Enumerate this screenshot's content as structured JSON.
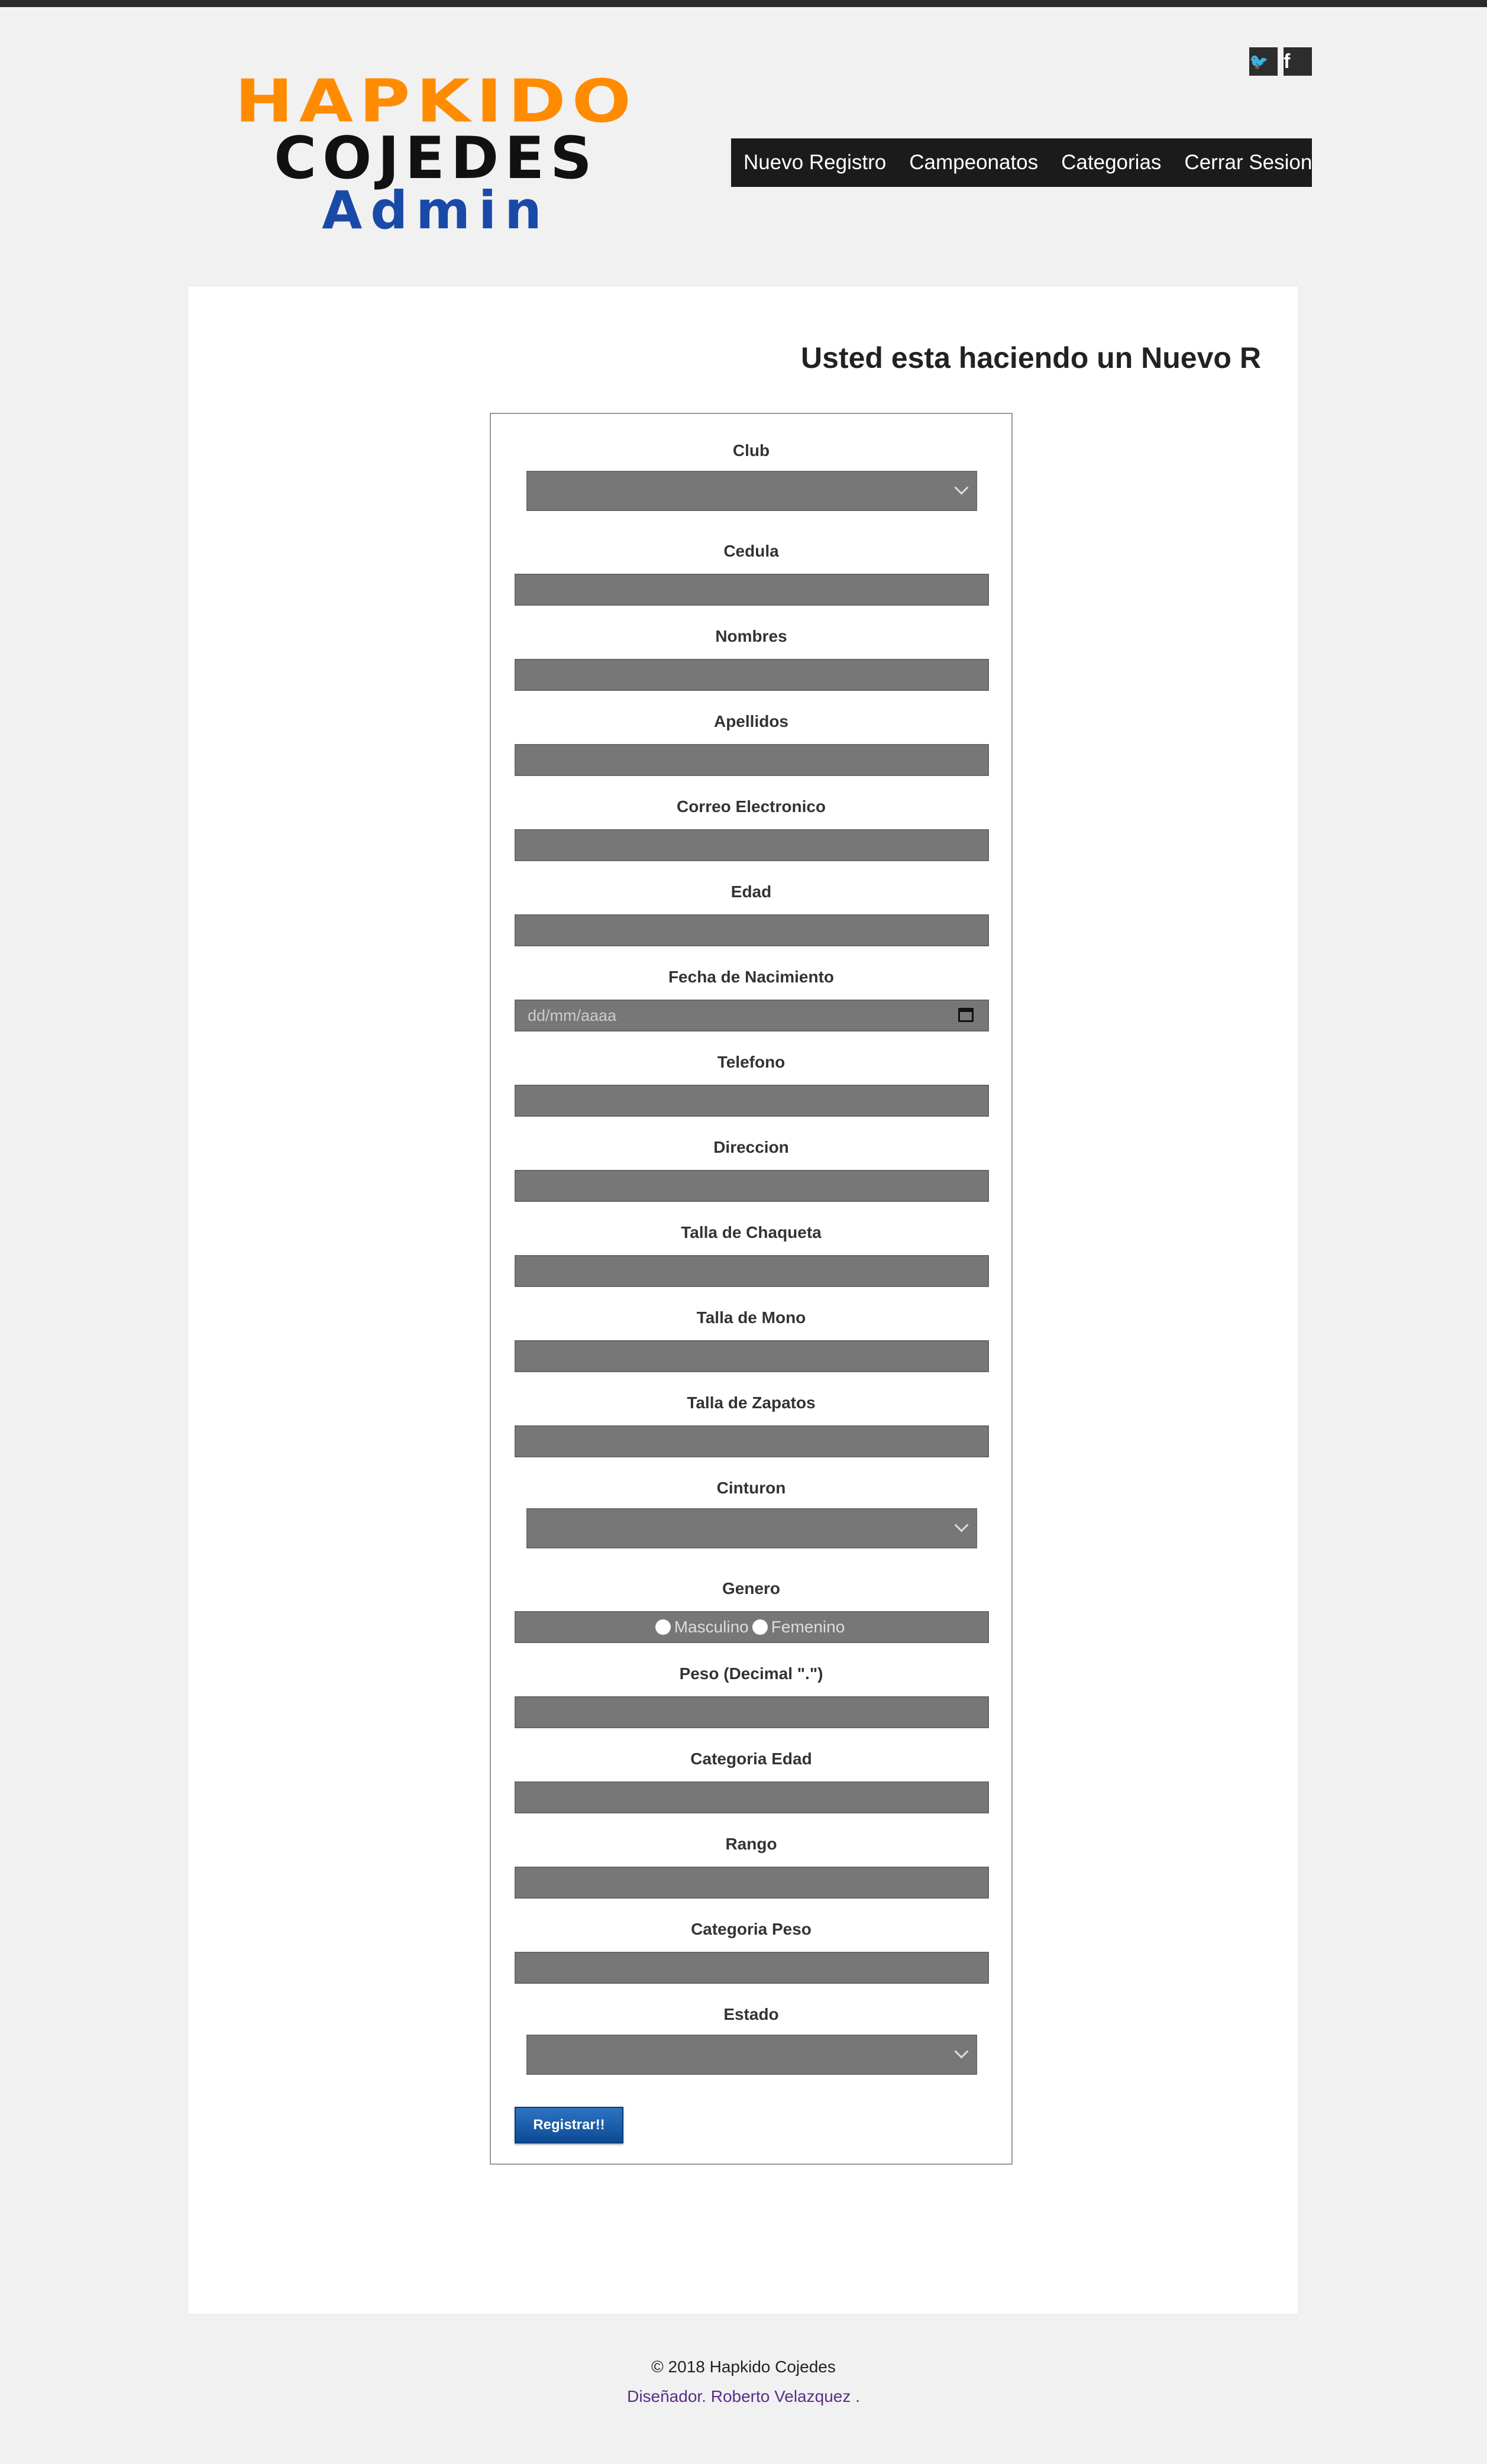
{
  "logo": {
    "line1": "HAPKIDO",
    "line2": "COJEDES",
    "line3": "Admin",
    "colors": {
      "line1": "#ff8c00",
      "line2": "#111111",
      "line3": "#1a4aa8"
    }
  },
  "social": [
    {
      "name": "twitter-icon",
      "glyph": "🐦"
    },
    {
      "name": "facebook-icon",
      "glyph": "f"
    }
  ],
  "nav": {
    "items": [
      "Nuevo Registro",
      "Campeonatos",
      "Categorias",
      "Cerrar Sesion"
    ]
  },
  "headline": "Usted esta haciendo un Nuevo Registro",
  "form": {
    "fields": [
      {
        "label": "Club",
        "type": "select"
      },
      {
        "label": "Cedula",
        "type": "text"
      },
      {
        "label": "Nombres",
        "type": "text"
      },
      {
        "label": "Apellidos",
        "type": "text"
      },
      {
        "label": "Correo Electronico",
        "type": "text"
      },
      {
        "label": "Edad",
        "type": "text"
      },
      {
        "label": "Fecha de Nacimiento",
        "type": "date",
        "placeholder": "dd/mm/aaaa"
      },
      {
        "label": "Telefono",
        "type": "text"
      },
      {
        "label": "Direccion",
        "type": "text"
      },
      {
        "label": "Talla de Chaqueta",
        "type": "text"
      },
      {
        "label": "Talla de Mono",
        "type": "text"
      },
      {
        "label": "Talla de Zapatos",
        "type": "text"
      },
      {
        "label": "Cinturon",
        "type": "select"
      },
      {
        "label": "Genero",
        "type": "radio",
        "options": [
          "Masculino",
          "Femenino"
        ]
      },
      {
        "label": "Peso (Decimal \".\")",
        "type": "text"
      },
      {
        "label": "Categoria Edad",
        "type": "text"
      },
      {
        "label": "Rango",
        "type": "text"
      },
      {
        "label": "Categoria Peso",
        "type": "text"
      },
      {
        "label": "Estado",
        "type": "select"
      }
    ],
    "submit_label": "Registrar!!"
  },
  "footer": {
    "copyright": "© 2018 Hapkido Cojedes",
    "designer": "Diseñador. Roberto Velazquez ."
  }
}
